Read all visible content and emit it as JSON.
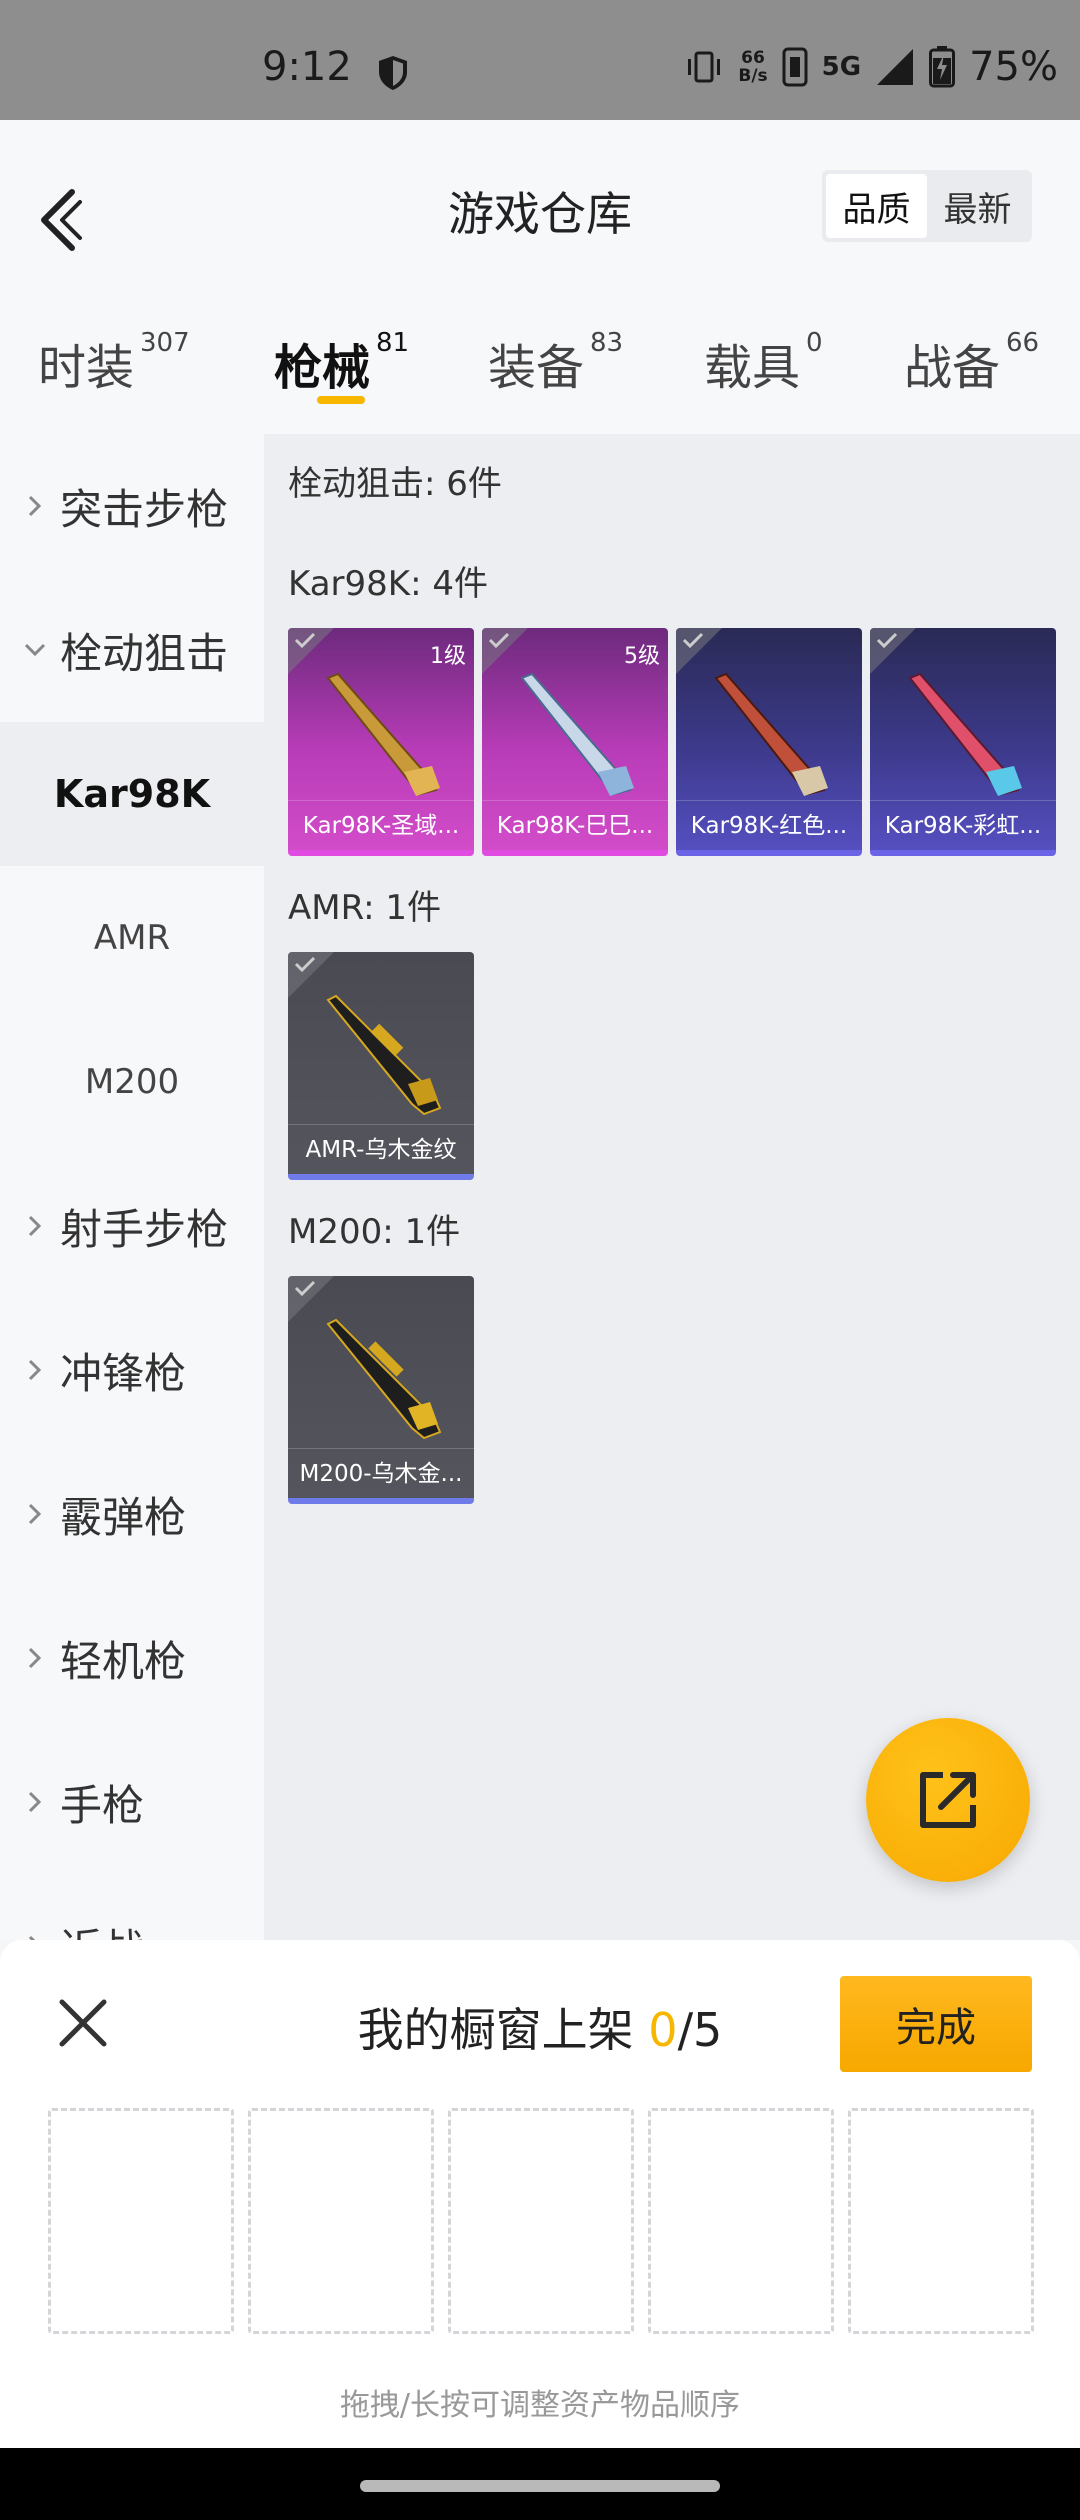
{
  "status_bar": {
    "time": "9:12",
    "net_speed_value": "66",
    "net_speed_unit": "B/s",
    "network": "5G",
    "battery": "75%"
  },
  "header": {
    "title": "游戏仓库",
    "sort_options": [
      "品质",
      "最新"
    ],
    "sort_selected": "品质"
  },
  "tabs": [
    {
      "label": "时装",
      "count": "307"
    },
    {
      "label": "枪械",
      "count": "81"
    },
    {
      "label": "装备",
      "count": "83"
    },
    {
      "label": "载具",
      "count": "0"
    },
    {
      "label": "战备",
      "count": "66"
    }
  ],
  "active_tab": "枪械",
  "sidebar": {
    "items": [
      {
        "label": "突击步枪"
      },
      {
        "label": "栓动狙击"
      },
      {
        "label": "Kar98K"
      },
      {
        "label": "AMR"
      },
      {
        "label": "M200"
      },
      {
        "label": "射手步枪"
      },
      {
        "label": "冲锋枪"
      },
      {
        "label": "霰弹枪"
      },
      {
        "label": "轻机枪"
      },
      {
        "label": "手枪"
      },
      {
        "label": "近战"
      }
    ]
  },
  "content": {
    "section_title": "栓动狙击: 6件",
    "groups": [
      {
        "title": "Kar98K: 4件",
        "cards": [
          {
            "name": "Kar98K-圣域...",
            "level": "1级",
            "color": "#c040c0"
          },
          {
            "name": "Kar98K-巳巳...",
            "level": "5级",
            "color": "#c040c0"
          },
          {
            "name": "Kar98K-红色...",
            "level": "",
            "color": "#4a45a8"
          },
          {
            "name": "Kar98K-彩虹...",
            "level": "",
            "color": "#4a45a8"
          }
        ]
      },
      {
        "title": "AMR: 1件",
        "cards": [
          {
            "name": "AMR-乌木金纹",
            "level": "",
            "color": "#55555e"
          }
        ]
      },
      {
        "title": "M200: 1件",
        "cards": [
          {
            "name": "M200-乌木金...",
            "level": "",
            "color": "#55555e"
          }
        ]
      }
    ]
  },
  "sheet": {
    "title_prefix": "我的橱窗上架 ",
    "count_current": "0",
    "count_total": "/5",
    "done_label": "完成",
    "hint": "拖拽/长按可调整资产物品顺序",
    "accent_color": "#f7b600"
  },
  "icons": {
    "back": "chevron-left-icon",
    "fab": "share-edit-icon",
    "close": "close-icon"
  }
}
